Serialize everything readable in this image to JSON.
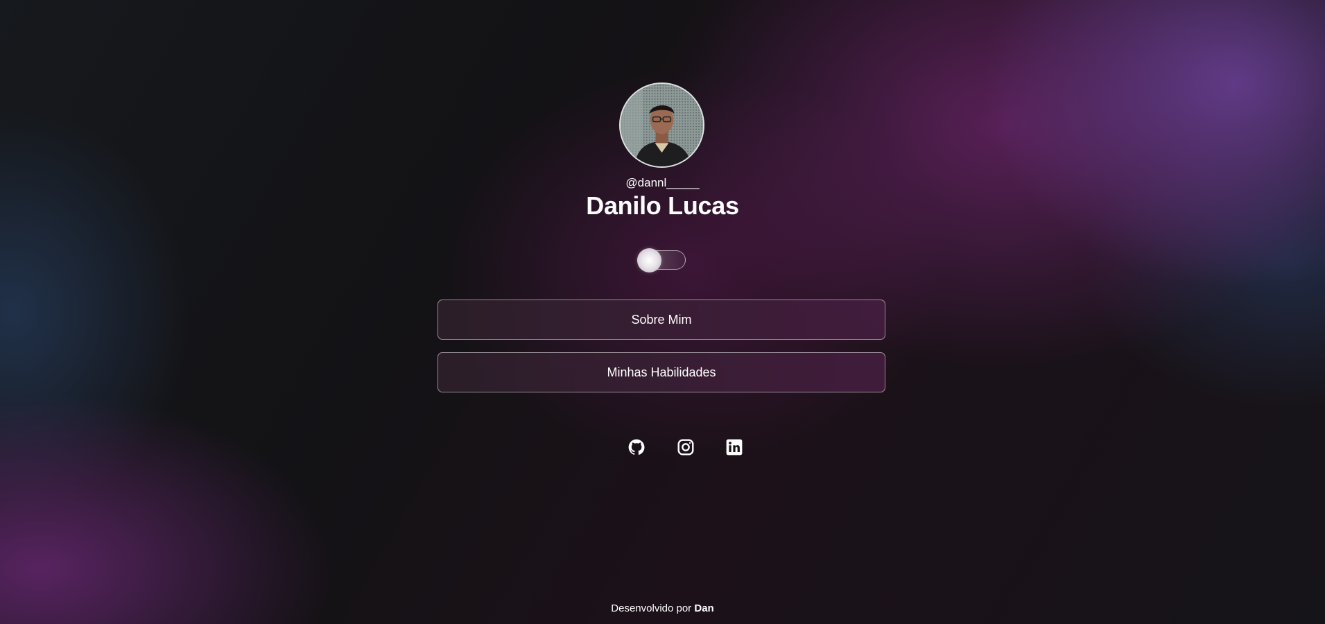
{
  "profile": {
    "handle": "@dannl_____",
    "name": "Danilo Lucas",
    "avatar_icon": "profile-photo"
  },
  "theme_toggle": {
    "state": "off"
  },
  "links": [
    {
      "label": "Sobre Mim"
    },
    {
      "label": "Minhas Habilidades"
    }
  ],
  "socials": [
    {
      "icon": "github-icon"
    },
    {
      "icon": "instagram-icon"
    },
    {
      "icon": "linkedin-icon"
    }
  ],
  "footer": {
    "prefix": "Desenvolvido por",
    "author": "Dan"
  },
  "colors": {
    "text": "#ffffff",
    "background": "#141216",
    "accent_purple": "#6a2f7a",
    "button_border": "#9a8f99"
  }
}
